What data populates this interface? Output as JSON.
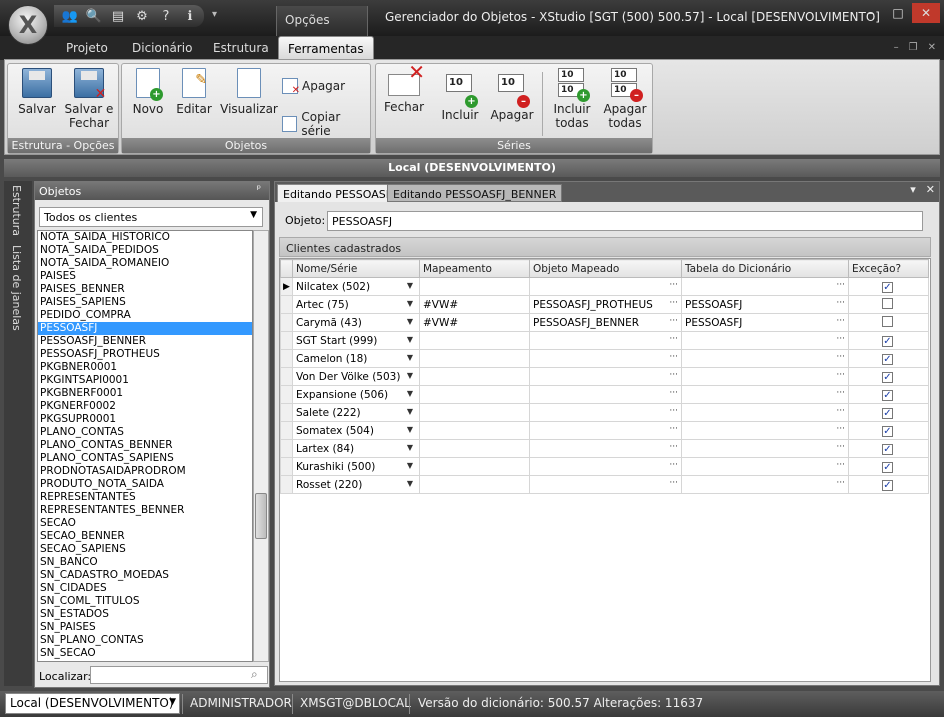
{
  "window": {
    "title": "Gerenciador do Objetos - XStudio [SGT (500) 500.57] - Local [DESENVOLVIMENTO]",
    "context_tab": "Opções",
    "app_button": "X",
    "controls": {
      "min": "–",
      "max": "□",
      "close": "✕"
    }
  },
  "ribbon_tabs": [
    "Projeto",
    "Dicionário",
    "Estrutura",
    "Ferramentas"
  ],
  "ribbon": {
    "groups": {
      "estrutura": "Estrutura - Opções",
      "objetos": "Objetos",
      "series": "Séries"
    },
    "buttons": {
      "salvar": "Salvar",
      "salvar_fechar_1": "Salvar e",
      "salvar_fechar_2": "Fechar",
      "novo": "Novo",
      "editar": "Editar",
      "visualizar": "Visualizar",
      "apagar_obj": "Apagar",
      "copiar_serie": "Copiar série",
      "fechar": "Fechar",
      "incluir": "Incluir",
      "apagar": "Apagar",
      "incluir_todas_1": "Incluir",
      "incluir_todas_2": "todas",
      "apagar_todas_1": "Apagar",
      "apagar_todas_2": "todas"
    },
    "num_icon": "10"
  },
  "env_banner": "Local (DESENVOLVIMENTO)",
  "side_tabs": [
    "Estrutura",
    "Lista de janelas"
  ],
  "objects_panel": {
    "title": "Objetos",
    "filter": "Todos os clientes",
    "items": [
      "NOTA_SAIDA_HISTORICO",
      "NOTA_SAIDA_PEDIDOS",
      "NOTA_SAIDA_ROMANEIO",
      "PAISES",
      "PAISES_BENNER",
      "PAISES_SAPIENS",
      "PEDIDO_COMPRA",
      "PESSOASFJ",
      "PESSOASFJ_BENNER",
      "PESSOASFJ_PROTHEUS",
      "PKGBNER0001",
      "PKGINTSAPI0001",
      "PKGBNERF0001",
      "PKGNERF0002",
      "PKGSUPR0001",
      "PLANO_CONTAS",
      "PLANO_CONTAS_BENNER",
      "PLANO_CONTAS_SAPIENS",
      "PRODNOTASAIDAPRODROM",
      "PRODUTO_NOTA_SAIDA",
      "REPRESENTANTES",
      "REPRESENTANTES_BENNER",
      "SECAO",
      "SECAO_BENNER",
      "SECAO_SAPIENS",
      "SN_BANCO",
      "SN_CADASTRO_MOEDAS",
      "SN_CIDADES",
      "SN_COML_TITULOS",
      "SN_ESTADOS",
      "SN_PAISES",
      "SN_PLANO_CONTAS",
      "SN_SECAO"
    ],
    "selected": "PESSOASFJ",
    "find_label": "Localizar:"
  },
  "editor": {
    "tabs": [
      "Editando PESSOASFJ",
      "Editando PESSOASFJ_BENNER"
    ],
    "object_label": "Objeto:",
    "object_value": "PESSOASFJ",
    "clients_header": "Clientes cadastrados",
    "columns": [
      "Nome/Série",
      "Mapeamento",
      "Objeto Mapeado",
      "Tabela do Dicionário",
      "Exceção?"
    ],
    "rows": [
      {
        "name": "Nilcatex (502)",
        "map": "",
        "obj": "",
        "tab": "",
        "exc": true,
        "current": true
      },
      {
        "name": "Artec (75)",
        "map": "#VW#",
        "obj": "PESSOASFJ_PROTHEUS",
        "tab": "PESSOASFJ",
        "exc": false
      },
      {
        "name": "Carymã (43)",
        "map": "#VW#",
        "obj": "PESSOASFJ_BENNER",
        "tab": "PESSOASFJ",
        "exc": false
      },
      {
        "name": "SGT Start (999)",
        "map": "",
        "obj": "",
        "tab": "",
        "exc": true
      },
      {
        "name": "Camelon (18)",
        "map": "",
        "obj": "",
        "tab": "",
        "exc": true
      },
      {
        "name": "Von Der Völke (503)",
        "map": "",
        "obj": "",
        "tab": "",
        "exc": true
      },
      {
        "name": "Expansione (506)",
        "map": "",
        "obj": "",
        "tab": "",
        "exc": true
      },
      {
        "name": "Salete (222)",
        "map": "",
        "obj": "",
        "tab": "",
        "exc": true
      },
      {
        "name": "Somatex (504)",
        "map": "",
        "obj": "",
        "tab": "",
        "exc": true
      },
      {
        "name": "Lartex (84)",
        "map": "",
        "obj": "",
        "tab": "",
        "exc": true
      },
      {
        "name": "Kurashiki (500)",
        "map": "",
        "obj": "",
        "tab": "",
        "exc": true
      },
      {
        "name": "Rosset (220)",
        "map": "",
        "obj": "",
        "tab": "",
        "exc": true
      }
    ]
  },
  "statusbar": {
    "env": "Local (DESENVOLVIMENTO)",
    "user": "ADMINISTRADOR",
    "db": "XMSGT@DBLOCAL",
    "version": "Versão do dicionário: 500.57 Alterações: 11637"
  }
}
